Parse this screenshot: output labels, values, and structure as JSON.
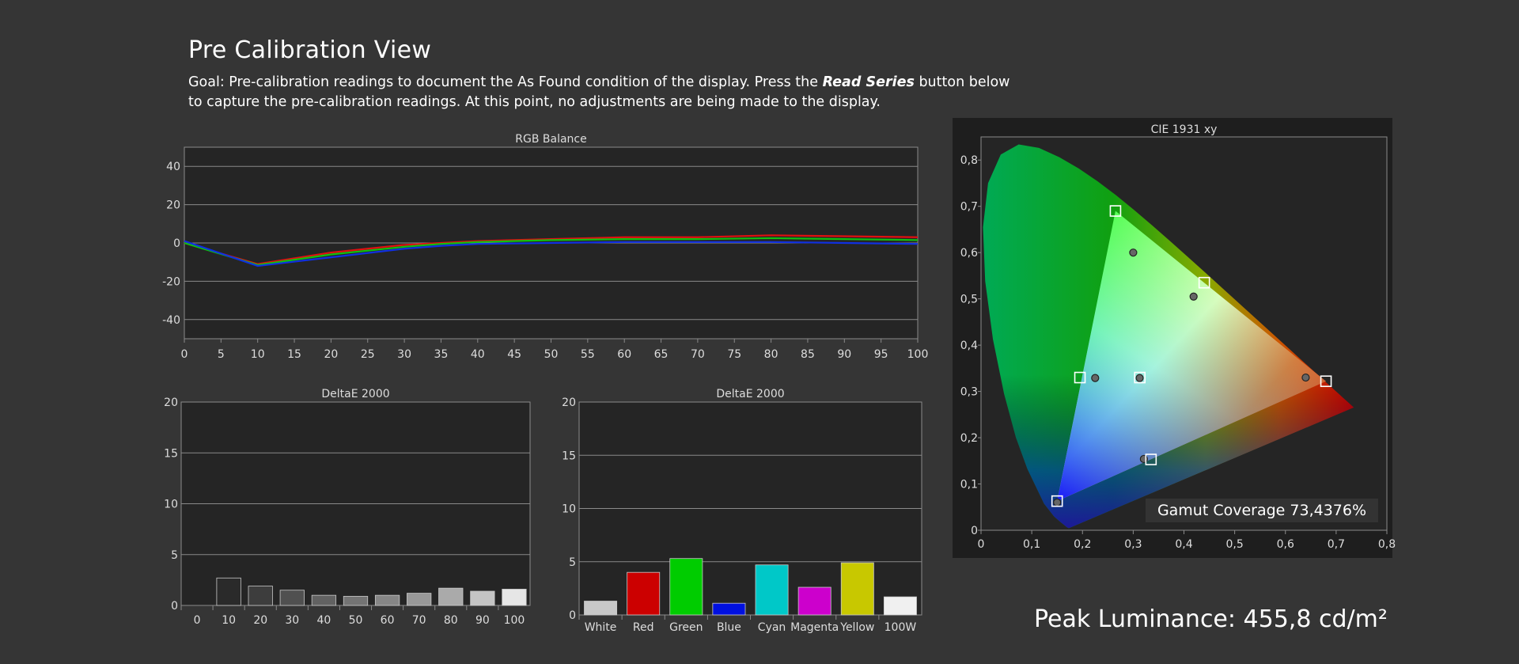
{
  "page": {
    "title": "Pre Calibration View",
    "goal_prefix": "Goal: Pre-calibration readings to document the As Found condition of the display. Press the ",
    "goal_emphasis": "Read Series",
    "goal_suffix": " button below to capture the pre-calibration readings. At this point, no adjustments are being made to the display.",
    "peak_luminance": "Peak Luminance: 455,8 cd/m²",
    "gamut_coverage": "Gamut Coverage 73,4376%"
  },
  "colors": {
    "background": "#353535",
    "plot_bg": "#252525",
    "red_series": "#e01010",
    "green_series": "#10c010",
    "blue_series": "#1030e0"
  },
  "chart_data": [
    {
      "type": "line",
      "title": "RGB Balance",
      "x": [
        0,
        10,
        20,
        30,
        35,
        40,
        50,
        60,
        70,
        80,
        90,
        100
      ],
      "series": [
        {
          "color": "#e01010",
          "values": [
            0,
            -11,
            -5,
            -1,
            0,
            1,
            2,
            3,
            3,
            4,
            3.5,
            3
          ]
        },
        {
          "color": "#10c010",
          "values": [
            0,
            -11.5,
            -6,
            -2,
            -0.5,
            0.5,
            1.5,
            2,
            2,
            2.5,
            2,
            1.5
          ]
        },
        {
          "color": "#1030e0",
          "values": [
            1,
            -12,
            -7.5,
            -3,
            -1.5,
            -0.5,
            0,
            0.5,
            0.5,
            0.5,
            0,
            -0.5
          ]
        }
      ],
      "xlim": [
        0,
        100
      ],
      "ylim": [
        -50,
        50
      ],
      "xticks": [
        "0",
        "5",
        "10",
        "15",
        "20",
        "25",
        "30",
        "35",
        "40",
        "45",
        "50",
        "55",
        "60",
        "65",
        "70",
        "75",
        "80",
        "85",
        "90",
        "95",
        "100"
      ],
      "yticks": [
        "40",
        "20",
        "0",
        "-20",
        "-40"
      ],
      "grid": true
    },
    {
      "type": "bar",
      "title": "DeltaE 2000",
      "categories": [
        "0",
        "10",
        "20",
        "30",
        "40",
        "50",
        "60",
        "70",
        "80",
        "90",
        "100"
      ],
      "values": [
        0,
        2.7,
        1.9,
        1.5,
        1.0,
        0.9,
        1.0,
        1.2,
        1.7,
        1.4,
        1.6
      ],
      "bar_colors": [
        "#000000",
        "#2a2a2a",
        "#3d3d3d",
        "#505050",
        "#626262",
        "#747474",
        "#868686",
        "#989898",
        "#aaaaaa",
        "#c4c4c4",
        "#e6e6e6"
      ],
      "ylim": [
        0,
        20
      ],
      "yticks": [
        "20",
        "15",
        "10",
        "5",
        "0"
      ],
      "grid": true
    },
    {
      "type": "bar",
      "title": "DeltaE 2000",
      "categories": [
        "White",
        "Red",
        "Green",
        "Blue",
        "Cyan",
        "Magenta",
        "Yellow",
        "100W"
      ],
      "values": [
        1.3,
        4.0,
        5.3,
        1.1,
        4.7,
        2.6,
        4.9,
        1.7
      ],
      "bar_colors": [
        "#c8c8c8",
        "#cc0000",
        "#00cc00",
        "#0010e0",
        "#00c8c8",
        "#cc00cc",
        "#c8c800",
        "#f0f0f0"
      ],
      "ylim": [
        0,
        20
      ],
      "yticks": [
        "20",
        "15",
        "10",
        "5",
        "0"
      ],
      "grid": true
    },
    {
      "type": "scatter",
      "title": "CIE 1931 xy",
      "xlim": [
        0,
        0.8
      ],
      "ylim": [
        0,
        0.85
      ],
      "xticks": [
        "0",
        "0,1",
        "0,2",
        "0,3",
        "0,4",
        "0,5",
        "0,6",
        "0,7",
        "0,8"
      ],
      "yticks": [
        "0,8",
        "0,7",
        "0,6",
        "0,5",
        "0,4",
        "0,3",
        "0,2",
        "0,1",
        "0"
      ],
      "targets": [
        [
          0.64,
          0.33
        ],
        [
          0.3,
          0.6
        ],
        [
          0.15,
          0.06
        ],
        [
          0.3127,
          0.329
        ],
        [
          0.225,
          0.329
        ],
        [
          0.321,
          0.154
        ],
        [
          0.419,
          0.505
        ]
      ],
      "measured": [
        [
          0.68,
          0.322
        ],
        [
          0.265,
          0.69
        ],
        [
          0.15,
          0.063
        ],
        [
          0.313,
          0.33
        ],
        [
          0.195,
          0.33
        ],
        [
          0.335,
          0.153
        ],
        [
          0.44,
          0.535
        ]
      ],
      "grid": true
    }
  ]
}
